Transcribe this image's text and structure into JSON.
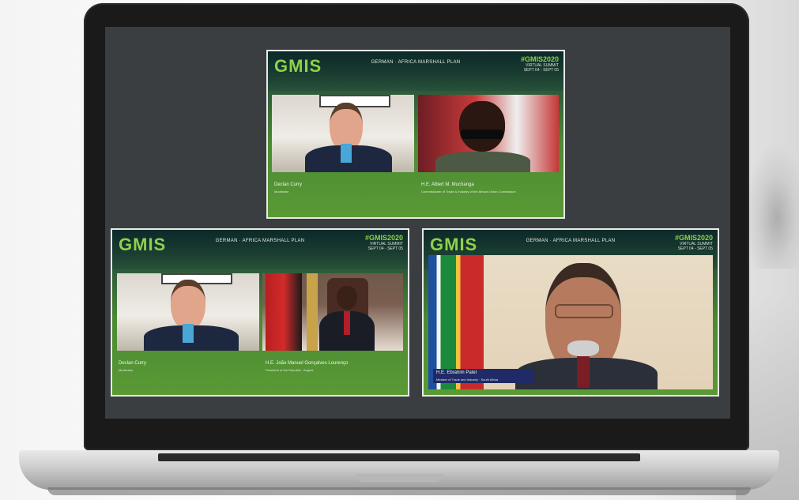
{
  "summit": {
    "logo": "GMIS",
    "plan": "GERMAN · AFRICA MARSHALL PLAN",
    "hashtag": "#GMIS2020",
    "subtitle1": "VIRTUAL SUMMIT",
    "subtitle2": "SEPT 04 - SEPT 05"
  },
  "panels": [
    {
      "participants": [
        {
          "name": "Declan Curry",
          "title": "Moderator"
        },
        {
          "name": "H.E. Albert M. Muchanga",
          "title": "Commissioner of Trade & Industry of the African Union Commission"
        }
      ]
    },
    {
      "participants": [
        {
          "name": "Declan Curry",
          "title": "Moderator"
        },
        {
          "name": "H.E. João Manuel Gonçalves Lourenço",
          "title": "President of the Republic · Angola"
        }
      ]
    },
    {
      "participants": [
        {
          "name": "H.E. Ebrahim Patel",
          "title": "Minister of Trade and Industry · South Africa"
        }
      ]
    }
  ],
  "colors": {
    "accent": "#8ed14b",
    "panel_green": "#4b8a33",
    "screen": "#3a3e41",
    "name_box": "#1f2a66"
  }
}
